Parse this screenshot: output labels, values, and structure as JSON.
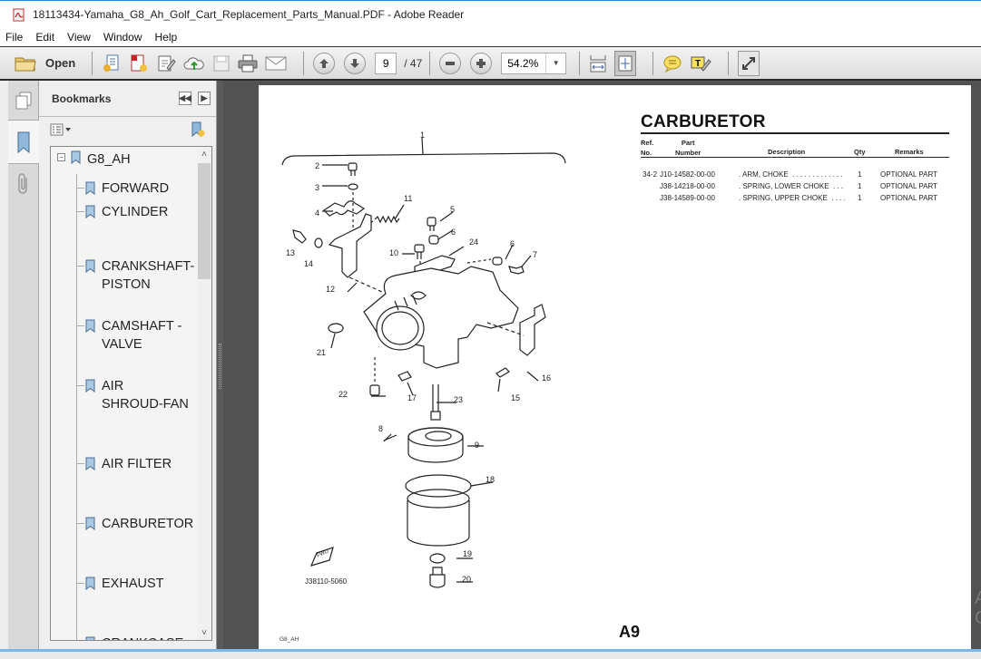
{
  "window": {
    "title": "18113434-Yamaha_G8_Ah_Golf_Cart_Replacement_Parts_Manual.PDF - Adobe Reader"
  },
  "menu": [
    "File",
    "Edit",
    "View",
    "Window",
    "Help"
  ],
  "toolbar": {
    "open_label": "Open",
    "current_page": "9",
    "total_pages": "/ 47",
    "zoom_level": "54.2%"
  },
  "sidebar": {
    "title": "Bookmarks",
    "root": "G8_AH",
    "items": [
      {
        "label": "FORWARD"
      },
      {
        "label": "CYLINDER"
      },
      {
        "label": "CRANKSHAFT-\nPISTON"
      },
      {
        "label": "CAMSHAFT -\nVALVE"
      },
      {
        "label": "AIR\nSHROUD-FAN"
      },
      {
        "label": "AIR FILTER"
      },
      {
        "label": "CARBURETOR"
      },
      {
        "label": "EXHAUST"
      },
      {
        "label": "CRANKCASE"
      }
    ]
  },
  "document": {
    "section_title": "CARBURETOR",
    "headers": {
      "ref": "Ref.\nNo.",
      "part": "Part\nNumber",
      "description": "Description",
      "qty": "Qty",
      "remarks": "Remarks"
    },
    "rows": [
      {
        "ref": "34-2",
        "part": "J10-14582-00-00",
        "description": ". ARM, CHOKE  . . . . . . . . . . . . .",
        "qty": "1",
        "remarks": "OPTIONAL PART"
      },
      {
        "ref": "",
        "part": "J38-14218-00-00",
        "description": ". SPRING, LOWER CHOKE  . . .",
        "qty": "1",
        "remarks": "OPTIONAL PART"
      },
      {
        "ref": "",
        "part": "J38-14589-00-00",
        "description": ". SPRING, UPPER CHOKE  . . . .",
        "qty": "1",
        "remarks": "OPTIONAL PART"
      }
    ],
    "diagram_labels": [
      "1",
      "2",
      "3",
      "4",
      "5",
      "6",
      "6",
      "7",
      "8",
      "9",
      "10",
      "11",
      "12",
      "13",
      "14",
      "15",
      "16",
      "17",
      "18",
      "19",
      "20",
      "21",
      "22",
      "23",
      "24"
    ],
    "diagram_code": "J38110-5060",
    "fwd_label": "FWD",
    "footer_left": "G8_AH",
    "page_label": "A9"
  },
  "watermark": "A\nG"
}
